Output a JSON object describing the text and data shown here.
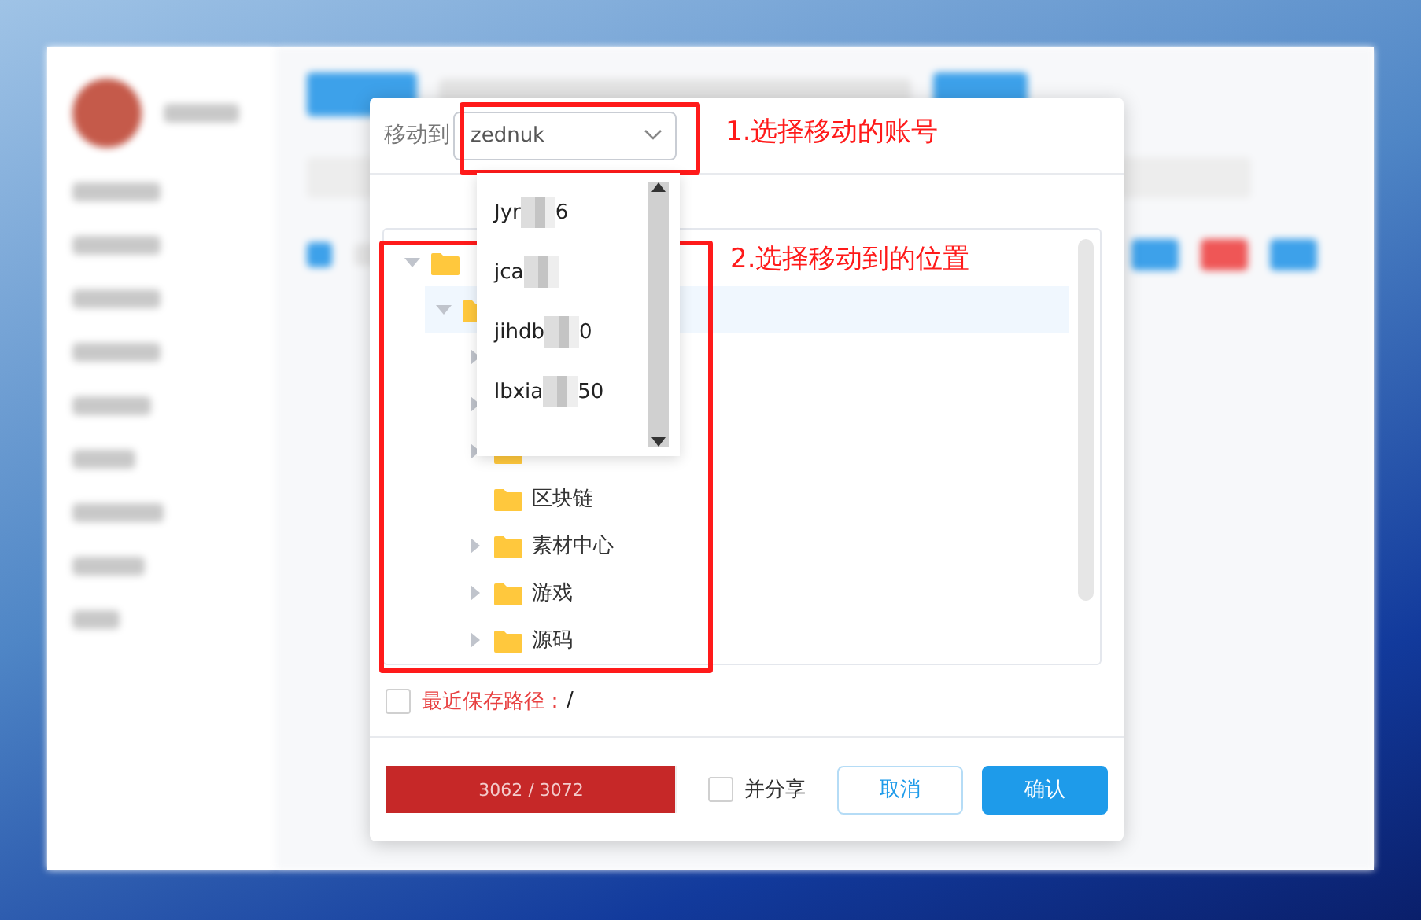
{
  "dialog": {
    "label": "移动到",
    "account_select": {
      "value": "zednuk",
      "expanded": true
    },
    "account_options": [
      {
        "start": "Jyr",
        "end": "6"
      },
      {
        "start": "jca"
      },
      {
        "start": "jihdb",
        "end": "0"
      },
      {
        "start": "lbxia",
        "end": "50"
      }
    ],
    "folder_tree": [
      {
        "expanded": true,
        "has_children": true,
        "selected": false,
        "children": [
          {
            "expanded": true,
            "has_children": true,
            "selected": true,
            "children": [
              {
                "has_children": true,
                "selected": false
              },
              {
                "has_children": true,
                "selected": false
              },
              {
                "has_children": true,
                "selected": false
              },
              {
                "label": "区块链",
                "has_children": false,
                "selected": false
              },
              {
                "label": "素材中心",
                "has_children": true,
                "selected": false
              },
              {
                "label": "游戏",
                "has_children": true,
                "selected": false
              },
              {
                "label": "源码",
                "has_children": true,
                "selected": false
              }
            ]
          }
        ]
      }
    ],
    "recent_path": {
      "checked": false,
      "label": "最近保存路径：",
      "value": "/"
    },
    "quota": {
      "text": "3062 / 3072",
      "level": 0.997
    },
    "share": {
      "label": "并分享",
      "checked": false
    },
    "buttons": [
      {
        "label": "取消",
        "kind": "secondary"
      },
      {
        "label": "确认",
        "kind": "primary"
      }
    ]
  },
  "annotations": [
    {
      "text": "1.选择移动的账号"
    },
    {
      "text": "2.选择移动到的位置"
    }
  ]
}
